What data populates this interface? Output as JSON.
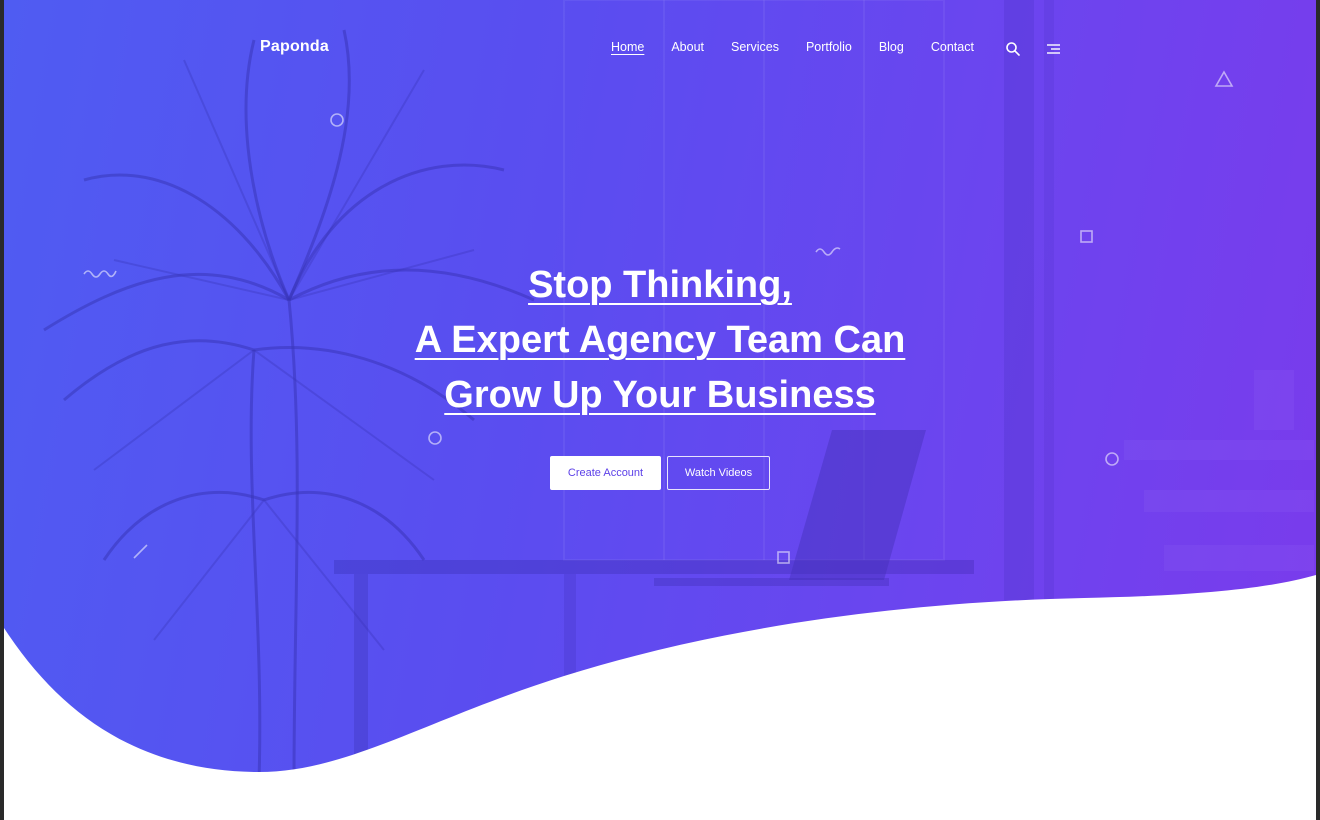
{
  "brand": {
    "name": "Paponda",
    "gradient_start": "#4f5cf2",
    "gradient_end": "#7a3bec"
  },
  "nav": {
    "items": [
      {
        "label": "Home",
        "active": true
      },
      {
        "label": "About",
        "active": false
      },
      {
        "label": "Services",
        "active": false
      },
      {
        "label": "Portfolio",
        "active": false
      },
      {
        "label": "Blog",
        "active": false
      },
      {
        "label": "Contact",
        "active": false
      }
    ],
    "search_icon": "search-icon",
    "menu_icon": "hamburger-menu-icon"
  },
  "hero": {
    "line1": "Stop Thinking,",
    "line2": "A Expert Agency Team Can",
    "line3": "Grow Up Your Business",
    "primary_button": "Create Account",
    "secondary_button": "Watch Videos"
  },
  "decorations": [
    "triangle-outline",
    "circle-outline",
    "square-outline",
    "squiggle",
    "line-stroke"
  ]
}
